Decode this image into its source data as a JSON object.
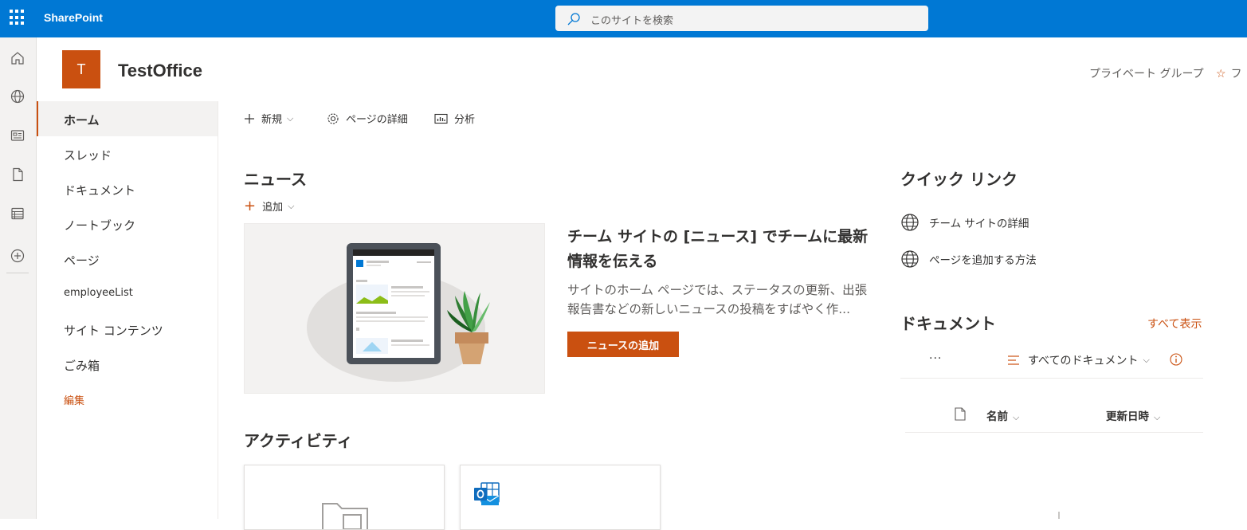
{
  "suite": {
    "brand": "SharePoint",
    "search_placeholder": "このサイトを検索"
  },
  "site": {
    "logo_letter": "T",
    "title": "TestOffice",
    "privacy": "プライベート グループ",
    "follow": "フ"
  },
  "nav": {
    "items": [
      {
        "label": "ホーム"
      },
      {
        "label": "スレッド"
      },
      {
        "label": "ドキュメント"
      },
      {
        "label": "ノートブック"
      },
      {
        "label": "ページ"
      },
      {
        "label": "employeeList"
      },
      {
        "label": "サイト コンテンツ"
      },
      {
        "label": "ごみ箱"
      },
      {
        "label": "編集"
      }
    ]
  },
  "commands": {
    "new_label": "新規",
    "details_label": "ページの詳細",
    "analytics_label": "分析"
  },
  "news": {
    "heading": "ニュース",
    "add_label": "追加",
    "headline": "チーム サイトの [ニュース] でチームに最新情報を伝える",
    "description": "サイトのホーム ページでは、ステータスの更新、出張報告書などの新しいニュースの投稿をすばやく作...",
    "button_label": "ニュースの追加"
  },
  "activity": {
    "heading": "アクティビティ"
  },
  "quick_links": {
    "heading": "クイック リンク",
    "items": [
      {
        "label": "チーム サイトの詳細"
      },
      {
        "label": "ページを追加する方法"
      }
    ]
  },
  "documents": {
    "heading": "ドキュメント",
    "see_all": "すべて表示",
    "more": "···",
    "view_label": "すべてのドキュメント",
    "col_name": "名前",
    "col_modified": "更新日時"
  },
  "colors": {
    "suite_bar": "#0078d4",
    "accent": "#ca5010"
  }
}
